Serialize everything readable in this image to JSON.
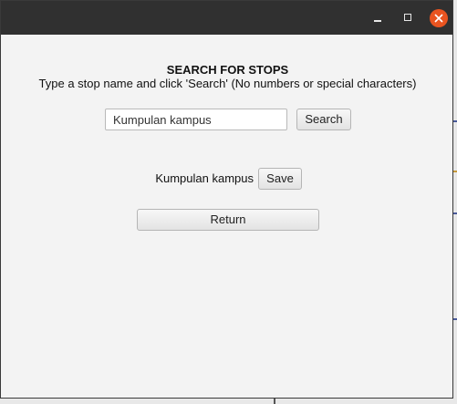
{
  "window": {
    "controls": {
      "minimize_icon": "minimize-icon",
      "maximize_icon": "maximize-icon",
      "close_icon": "close-icon",
      "close_color": "#e95420"
    }
  },
  "main": {
    "title": "SEARCH FOR STOPS",
    "instructions": "Type a stop name and click 'Search' (No numbers or special characters)",
    "search": {
      "value": "Kumpulan kampus",
      "placeholder": "",
      "button_label": "Search"
    },
    "result": {
      "stop_name": "Kumpulan kampus",
      "save_label": "Save"
    },
    "return_label": "Return"
  }
}
